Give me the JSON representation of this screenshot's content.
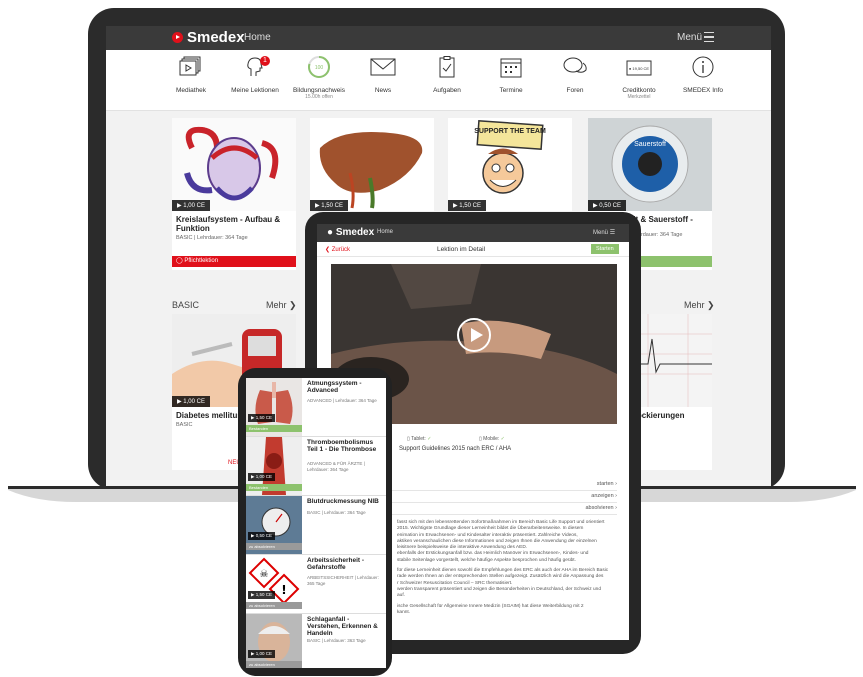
{
  "laptop": {
    "brand": "Smedex",
    "nav_home": "Home",
    "menu": "Menü",
    "icons": [
      {
        "label": "Mediathek",
        "icon": "media-library-icon"
      },
      {
        "label": "Meine Lektionen",
        "icon": "lessons-icon",
        "badge": "1"
      },
      {
        "label": "Bildungsnachweis",
        "icon": "progress-ring-icon",
        "sub": "15.00h offen",
        "ring_text": "100"
      },
      {
        "label": "News",
        "icon": "mail-icon"
      },
      {
        "label": "Aufgaben",
        "icon": "clipboard-check-icon"
      },
      {
        "label": "Termine",
        "icon": "calendar-icon"
      },
      {
        "label": "Foren",
        "icon": "chat-bubbles-icon"
      },
      {
        "label": "Creditkonto",
        "icon": "credit-card-icon",
        "sub": "Merkzettel",
        "card_text": "● 19,50 CE"
      },
      {
        "label": "SMEDEX Info",
        "icon": "info-icon"
      }
    ],
    "cards_row1": [
      {
        "title": "Kreislaufsystem - Aufbau & Funktion",
        "meta": "BASIC | Lehrdauer: 364 Tage",
        "ce": "▶ 1,00 CE",
        "tag": "Pflichtlektion"
      },
      {
        "title": "",
        "meta": "",
        "ce": "▶ 1,50 CE"
      },
      {
        "title": "",
        "meta": "",
        "ce": "▶ 1,50 CE"
      },
      {
        "title": "heit & Sauerstoff -",
        "meta": "T | Lehrdauer: 364 Tage",
        "ce": "▶ 0,50 CE",
        "img_text": "Sauerstoff"
      }
    ],
    "support_sign": "SUPPORT THE TEAM",
    "section_left": "BASIC",
    "more_left": "Mehr",
    "more_right": "Mehr",
    "cards_row2": [
      {
        "title": "Diabetes mellitus -",
        "meta": "BASIC",
        "ce": "▶ 1,00 CE",
        "tag": "NEU"
      },
      {
        "title": "/-Blockierungen",
        "meta": "e"
      }
    ]
  },
  "tablet": {
    "brand": "Smedex",
    "nav_home": "Home",
    "menu": "Menü",
    "back": "Zurück",
    "title": "Lektion im Detail",
    "start": "Starten",
    "device_tablet": "Tablet:",
    "device_mobile": "Mobile:",
    "subtitle": "Support Guidelines 2015 nach ERC / AHA",
    "rows": [
      "starten",
      "anzeigen",
      "absolvieren"
    ],
    "text": [
      "fasst sich mit den lebensrettenden Sofortmaßnahmen im Bereich Basic Life Support und orientiert",
      "2015. Wichtigste Grundlage dieser Lerneinheit bildet die Überarbeitensweise. In diesem",
      "enimation im Erwachsenen- und Kindesalter interaktiv präsentiert. Zahlreiche Videos,",
      "aktiken veranschaulichen diese Informationen und zeigen Ihnen die Anwendung der einzelnen",
      "leisitnere beispielsweise die interaktive Anwendung des AED.",
      "ebenfalls der Erstickungsanfall bzw. das Heimlich Manöver im Erwachsenen-, Kindes- und",
      "stabile Seitenlage vorgestellt, welche häufige Aspekte besprochen und häufig geübt.",
      "",
      "für diese Lerneinheit dienen sowohl die Empfehlungen des ERC als auch der AHA im Bereich Basic",
      "rade werden Ihnen an der entsprechenden Stellen aufgezeigt. Zusätzlich wird die Anpassung des",
      "r Schweizer Resuscitation Council – SRC thematisiert.",
      "werden transparent präsentiert und zeigen die Besonderheiten in Deutschland, der Schweiz und",
      "auf.",
      "",
      "ische Gesellschaft für Allgemeine Innere Medizin (SGAIM) hat diese Weiterbildung mit 2",
      "kannt."
    ]
  },
  "phone": {
    "items": [
      {
        "title": "Atmungssystem - Advanced",
        "meta": "ADVANCED | Lehrdauer: 364 Tage",
        "ce": "▶ 1,50 CE",
        "status": "Bestanden",
        "status_color": "#8dc26d"
      },
      {
        "title": "Thromboembolismus Teil 1 - Die Thrombose",
        "meta": "ADVANCED & FÜR ÄRZTE | Lehrdauer: 364 Tage",
        "ce": "▶ 1,00 CE",
        "status": "Bestanden",
        "status_color": "#8dc26d"
      },
      {
        "title": "Blutdruckmessung NIB",
        "meta": "BASIC | Lehrdauer: 364 Tage",
        "ce": "▶ 0,50 CE",
        "status": "zu absolvieren",
        "status_color": "#9a9a9a"
      },
      {
        "title": "Arbeitssicherheit - Gefahrstoffe",
        "meta": "ARBEITSSICHERHEIT | Lehrdauer: 365 Tage",
        "ce": "▶ 1,50 CE",
        "status": "zu absolvieren",
        "status_color": "#9a9a9a"
      },
      {
        "title": "Schlaganfall - Verstehen, Erkennen & Handeln",
        "meta": "BASIC | Lehrdauer: 363 Tage",
        "ce": "▶ 1,00 CE",
        "status": "zu absolvieren",
        "status_color": "#9a9a9a"
      }
    ]
  },
  "colors": {
    "brand_red": "#e0101a",
    "success_green": "#8dc26d",
    "dark_bar": "#3a3a3a"
  }
}
